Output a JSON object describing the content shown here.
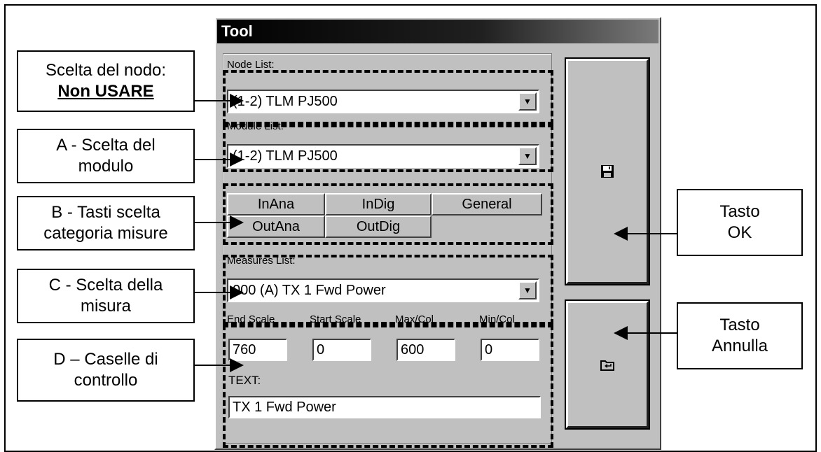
{
  "dialog": {
    "title": "Tool",
    "node_list_label": "Node List:",
    "node_list_value": "(1-2) TLM PJ500",
    "module_list_label": "Module List:",
    "module_list_value": "(1-2) TLM PJ500",
    "tabs": [
      "InAna",
      "InDig",
      "General",
      "OutAna",
      "OutDig"
    ],
    "measures_list_label": "Measures List:",
    "measures_list_value": "000 (A) TX 1 Fwd Power",
    "field_labels": [
      "End Scale",
      "Start Scale",
      "Max/Col",
      "Min/Col"
    ],
    "field_values": [
      "760",
      "0",
      "600",
      "0"
    ],
    "text_label": "TEXT:",
    "text_value": "TX 1 Fwd Power"
  },
  "icons": {
    "ok": "floppy-disk-icon",
    "cancel": "folder-back-icon",
    "dropdown": "chevron-down-icon"
  },
  "callouts": {
    "node": {
      "line1": "Scelta del nodo:",
      "line2": "Non USARE"
    },
    "module": {
      "line1": "A - Scelta del",
      "line2": "modulo"
    },
    "tabs": {
      "line1": "B - Tasti scelta",
      "line2": "categoria misure"
    },
    "measure": {
      "line1": "C - Scelta della",
      "line2": "misura"
    },
    "fields": {
      "line1": "D – Caselle di",
      "line2": "controllo"
    },
    "ok": {
      "line1": "Tasto",
      "line2": "OK"
    },
    "cancel": {
      "line1": "Tasto",
      "line2": "Annulla"
    }
  }
}
